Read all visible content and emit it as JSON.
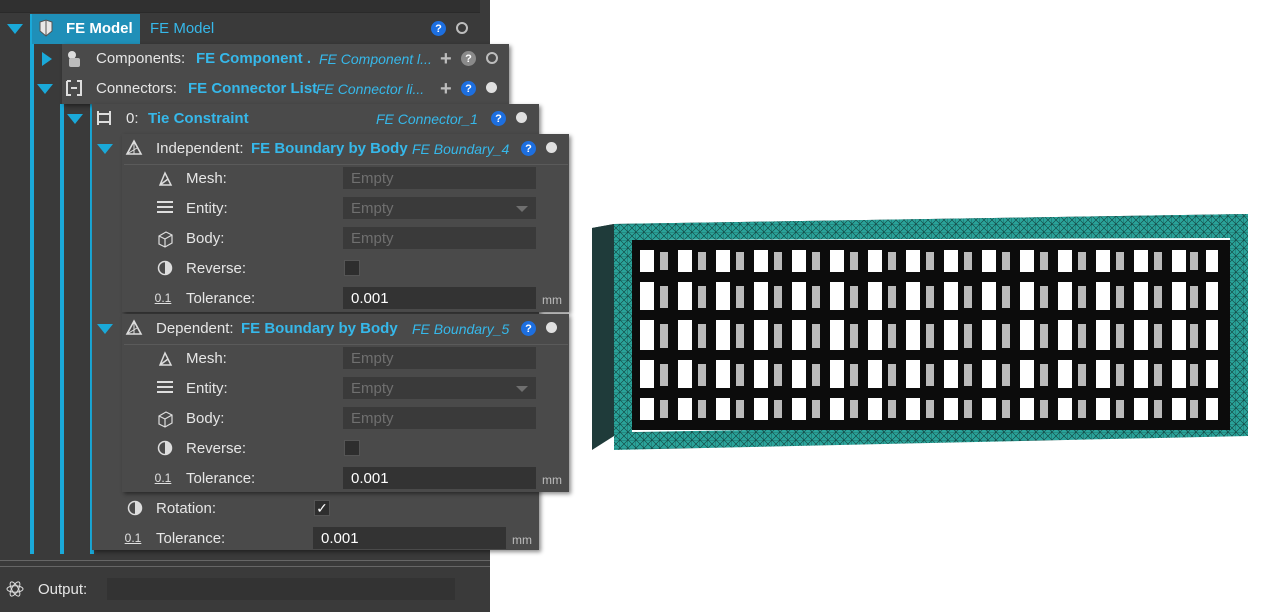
{
  "tree": {
    "fe_model": {
      "label": "FE Model",
      "value": "FE Model"
    },
    "components": {
      "label": "Components:",
      "link": "FE Component ...",
      "name": "FE Component l..."
    },
    "connectors": {
      "label": "Connectors:",
      "link": "FE Connector List",
      "name": "FE Connector li..."
    },
    "tie": {
      "index": "0:",
      "link": "Tie Constraint",
      "name": "FE Connector_1"
    },
    "independent": {
      "label": "Independent:",
      "link": "FE Boundary by Body",
      "name": "FE Boundary_4",
      "mesh_label": "Mesh:",
      "mesh_value": "Empty",
      "entity_label": "Entity:",
      "entity_value": "Empty",
      "body_label": "Body:",
      "body_value": "Empty",
      "reverse_label": "Reverse:",
      "tolerance_label": "Tolerance:",
      "tolerance_value": "0.001",
      "unit": "mm"
    },
    "dependent": {
      "label": "Dependent:",
      "link": "FE Boundary by Body",
      "name": "FE Boundary_5",
      "mesh_label": "Mesh:",
      "mesh_value": "Empty",
      "entity_label": "Entity:",
      "entity_value": "Empty",
      "body_label": "Body:",
      "body_value": "Empty",
      "reverse_label": "Reverse:",
      "tolerance_label": "Tolerance:",
      "tolerance_value": "0.001",
      "unit": "mm"
    },
    "rotation_label": "Rotation:",
    "rotation_checked": true,
    "tolerance_label": "Tolerance:",
    "tolerance_value": "0.001",
    "unit": "mm",
    "help_glyph": "?",
    "plus_glyph": "+",
    "check_glyph": "✓"
  },
  "output": {
    "label": "Output:"
  },
  "colors": {
    "accent": "#1aa9d9",
    "panel": "#4a4a4a",
    "mesh_teal": "#2aa39a",
    "body_dark": "#1f3b3a"
  }
}
